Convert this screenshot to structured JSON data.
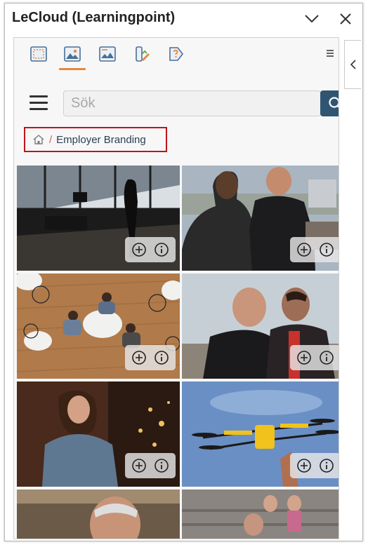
{
  "window": {
    "title": "LeCloud (Learningpoint)",
    "minimize_icon": "chevron-down-icon",
    "close_icon": "close-icon"
  },
  "toolbar": {
    "tools": [
      {
        "name": "select-region-icon"
      },
      {
        "name": "image-icon",
        "active": true
      },
      {
        "name": "gallery-icon"
      },
      {
        "name": "brand-palette-icon"
      },
      {
        "name": "help-tag-icon"
      }
    ],
    "accent_color": "#e8883a"
  },
  "search": {
    "placeholder": "Sök",
    "value": "",
    "button_icon": "search-icon",
    "button_color": "#2f5572"
  },
  "breadcrumb": {
    "home_icon": "home-icon",
    "separator": "/",
    "current": "Employer Branding",
    "highlight_color": "#c0131a"
  },
  "images": [
    {
      "scene": "office-silhouette"
    },
    {
      "scene": "two-men-talking-rooftop"
    },
    {
      "scene": "office-meeting-overhead"
    },
    {
      "scene": "two-men-city-view"
    },
    {
      "scene": "woman-with-phone"
    },
    {
      "scene": "yellow-drone"
    },
    {
      "scene": "man-portrait-office"
    },
    {
      "scene": "people-on-stairs"
    }
  ],
  "tile_actions": {
    "add_icon": "add-circle-icon",
    "info_icon": "info-circle-icon"
  }
}
